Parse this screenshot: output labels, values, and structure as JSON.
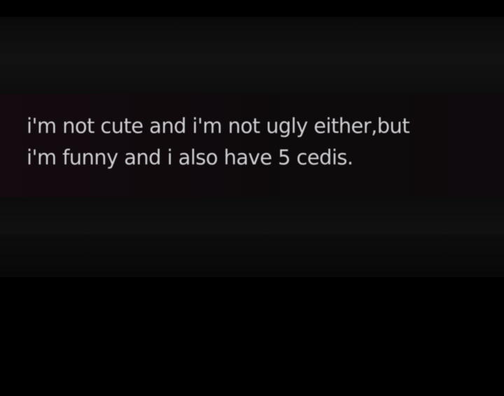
{
  "post": {
    "lines": [
      "i'm not cute and i'm not ugly either,but",
      "i'm funny and i also have 5 cedis."
    ]
  },
  "colors": {
    "background": "#000000",
    "text": "#cfcfd3"
  }
}
